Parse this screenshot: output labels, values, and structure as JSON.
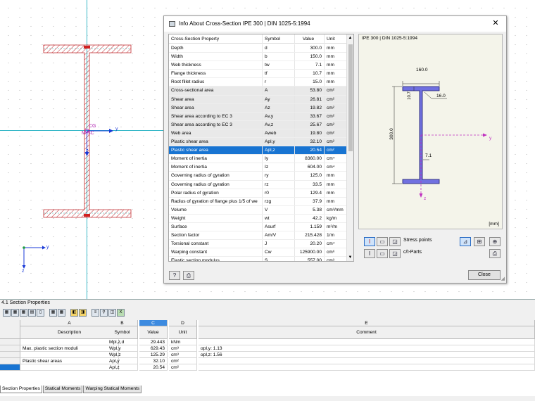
{
  "canvas": {
    "labels": {
      "cg": "CG",
      "mc": "M",
      "sc": "SC",
      "y_axis": "y",
      "z_axis": "z",
      "origin_y": "y",
      "origin_z": "z"
    }
  },
  "dialog": {
    "title": "Info About Cross-Section IPE 300 | DIN 1025-5:1994",
    "close_icon": "close-icon",
    "columns": {
      "property": "Cross-Section Property",
      "symbol": "Symbol",
      "value": "Value",
      "unit": "Unit"
    },
    "rows": [
      {
        "property": "Depth",
        "symbol": "d",
        "value": "300.0",
        "unit": "mm"
      },
      {
        "property": "Width",
        "symbol": "b",
        "value": "150.0",
        "unit": "mm"
      },
      {
        "property": "Web thickness",
        "symbol": "tw",
        "value": "7.1",
        "unit": "mm"
      },
      {
        "property": "Flange thickness",
        "symbol": "tf",
        "value": "10.7",
        "unit": "mm"
      },
      {
        "property": "Root fillet radius",
        "symbol": "r",
        "value": "15.0",
        "unit": "mm"
      },
      {
        "property": "Cross-sectional area",
        "symbol": "A",
        "value": "53.80",
        "unit": "cm²"
      },
      {
        "property": "Shear area",
        "symbol": "Ay",
        "value": "26.81",
        "unit": "cm²"
      },
      {
        "property": "Shear area",
        "symbol": "Az",
        "value": "19.82",
        "unit": "cm²"
      },
      {
        "property": "Shear area according to EC 3",
        "symbol": "Av,y",
        "value": "33.67",
        "unit": "cm²"
      },
      {
        "property": "Shear area according to EC 3",
        "symbol": "Av,z",
        "value": "25.67",
        "unit": "cm²"
      },
      {
        "property": "Web area",
        "symbol": "Aweb",
        "value": "19.80",
        "unit": "cm²"
      },
      {
        "property": "Plastic shear area",
        "symbol": "Apl,y",
        "value": "32.10",
        "unit": "cm²"
      },
      {
        "property": "Plastic shear area",
        "symbol": "Apl,z",
        "value": "20.54",
        "unit": "cm²"
      },
      {
        "property": "Moment of inertia",
        "symbol": "Iy",
        "value": "8360.00",
        "unit": "cm⁴"
      },
      {
        "property": "Moment of inertia",
        "symbol": "Iz",
        "value": "604.00",
        "unit": "cm⁴"
      },
      {
        "property": "Governing radius of gyration",
        "symbol": "ry",
        "value": "125.0",
        "unit": "mm"
      },
      {
        "property": "Governing radius of gyration",
        "symbol": "rz",
        "value": "33.5",
        "unit": "mm"
      },
      {
        "property": "Polar radius of gyration",
        "symbol": "r0",
        "value": "129.4",
        "unit": "mm"
      },
      {
        "property": "Radius of gyration of flange plus 1/5 of we",
        "symbol": "rzg",
        "value": "37.9",
        "unit": "mm"
      },
      {
        "property": "Volume",
        "symbol": "V",
        "value": "5.38",
        "unit": "cm³/mm"
      },
      {
        "property": "Weight",
        "symbol": "wt",
        "value": "42.2",
        "unit": "kg/m"
      },
      {
        "property": "Surface",
        "symbol": "Asurf",
        "value": "1.159",
        "unit": "m²/m"
      },
      {
        "property": "Section factor",
        "symbol": "Am/V",
        "value": "215.428",
        "unit": "1/m"
      },
      {
        "property": "Torsional constant",
        "symbol": "J",
        "value": "20.20",
        "unit": "cm⁴"
      },
      {
        "property": "Warping constant",
        "symbol": "Cw",
        "value": "125900.00",
        "unit": "cm⁶"
      },
      {
        "property": "Elastic section modulus",
        "symbol": "S",
        "value": "557.00",
        "unit": "cm³"
      }
    ],
    "selected_row": 12,
    "preview": {
      "title": "IPE 300 | DIN 1025-5:1994",
      "dim_width": "160.0",
      "dim_depth": "300.0",
      "dim_flange": "10.7",
      "dim_fillet": "16.0",
      "dim_web": "7.1",
      "axis_y": "y",
      "axis_z": "z",
      "unit_label": "[mm]"
    },
    "options": {
      "stress_points": "Stress points",
      "ct_parts": "c/t-Parts"
    },
    "close_button": "Close"
  },
  "panel": {
    "title": "4.1 Section Properties",
    "col_letters": [
      "A",
      "B",
      "C",
      "D",
      "E"
    ],
    "headers": {
      "description": "Description",
      "symbol": "Symbol",
      "value": "Value",
      "unit": "Unit",
      "comment": "Comment"
    },
    "rows": [
      {
        "description": "",
        "symbol": "Mpl,z,d",
        "value": "29.443",
        "unit": "kNm",
        "comment": ""
      },
      {
        "description": "Max. plastic section moduli",
        "symbol": "Wpl,y",
        "value": "629.43",
        "unit": "cm³",
        "comment": "αpl,y: 1.13"
      },
      {
        "description": "",
        "symbol": "Wpl,z",
        "value": "125.29",
        "unit": "cm³",
        "comment": "αpl,z: 1.56"
      },
      {
        "description": "Plastic shear areas",
        "symbol": "Apl,y",
        "value": "32.10",
        "unit": "cm²",
        "comment": ""
      },
      {
        "description": "",
        "symbol": "Apl,z",
        "value": "20.54",
        "unit": "cm²",
        "comment": ""
      }
    ],
    "tabs": [
      "Section Properties",
      "Statical Moments",
      "Warping Statical Moments"
    ]
  },
  "colors": {
    "accent": "#1874d2",
    "axis": "#1a3ad8",
    "hatch": "#c0282c",
    "section_fill": "#7070e0",
    "guide": "#38b8c8"
  }
}
